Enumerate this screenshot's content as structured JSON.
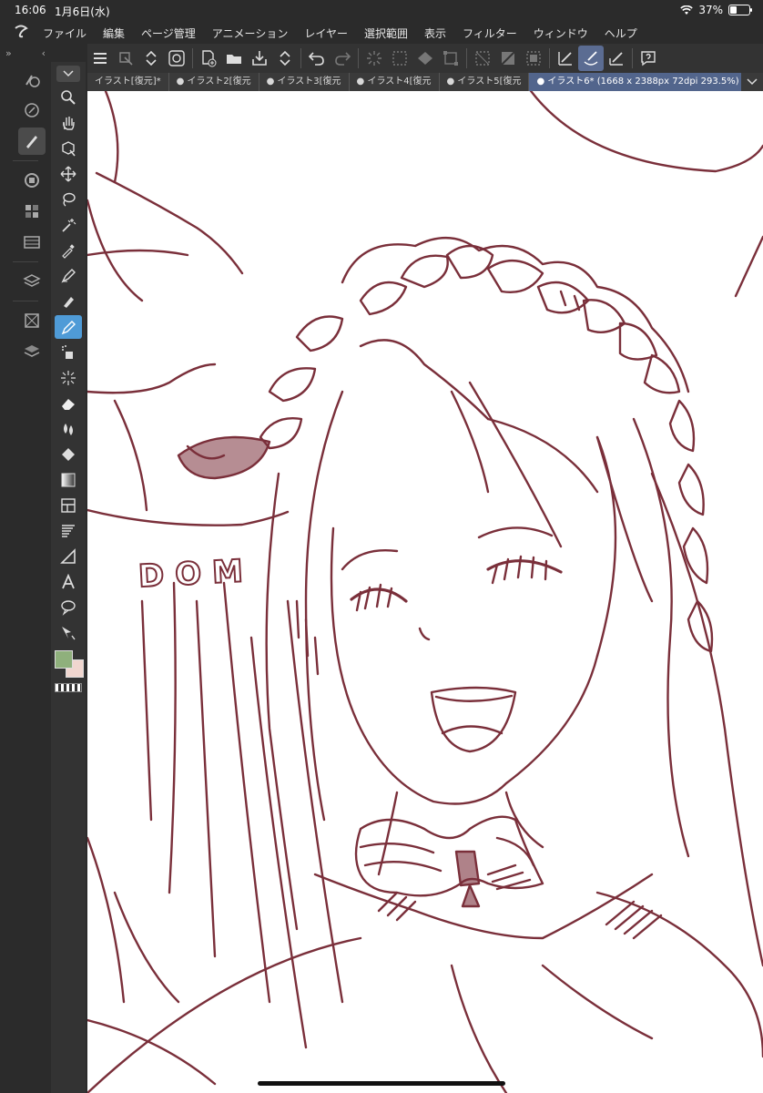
{
  "status": {
    "time": "16:06",
    "date": "1月6日(水)",
    "battery": "37%",
    "battery_level": 0.37
  },
  "menu": [
    "ファイル",
    "編集",
    "ページ管理",
    "アニメーション",
    "レイヤー",
    "選択範囲",
    "表示",
    "フィルター",
    "ウィンドウ",
    "ヘルプ"
  ],
  "tabs": [
    {
      "label": "イラスト[復元]*"
    },
    {
      "label": "● イラスト2[復元"
    },
    {
      "label": "● イラスト3[復元"
    },
    {
      "label": "● イラスト4[復元"
    },
    {
      "label": "● イラスト5[復元"
    },
    {
      "label": "● イラスト6* (1668 x 2388px 72dpi 293.5%)"
    }
  ],
  "active_tab": 5,
  "colors": {
    "main_color": "#8fb07c",
    "sub_color": "#f0d6cf",
    "line_color": "#7a2f3a",
    "accent": "#4f9bd7"
  },
  "canvas": {
    "drawn_text": "DOM"
  }
}
